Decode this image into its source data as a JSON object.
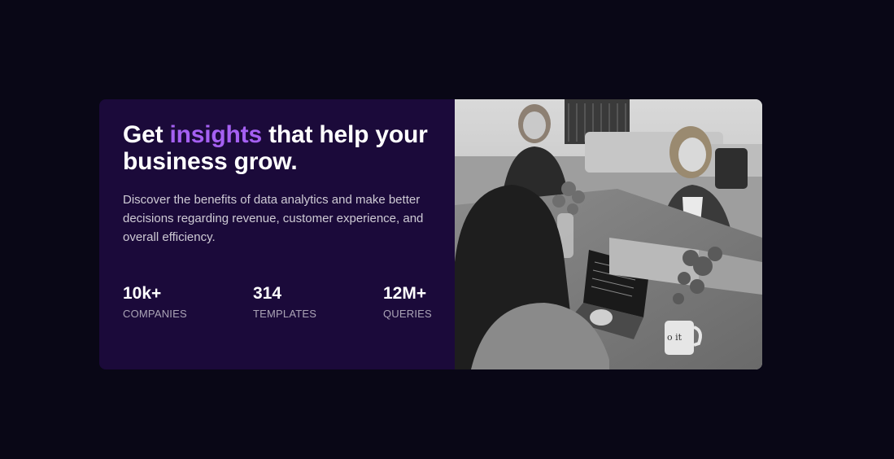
{
  "headline": {
    "prefix": "Get ",
    "accent": "insights",
    "suffix": " that help your business grow."
  },
  "description": "Discover the benefits of data analytics and make better decisions regarding revenue, customer experience, and overall efficiency.",
  "stats": [
    {
      "value": "10k+",
      "label": "COMPANIES"
    },
    {
      "value": "314",
      "label": "TEMPLATES"
    },
    {
      "value": "12M+",
      "label": "QUERIES"
    }
  ],
  "image": {
    "description_icon": "people-working-photo",
    "mug_text": "o it\nway"
  },
  "colors": {
    "page_bg": "#090716",
    "card_bg": "#1b0a3a",
    "accent": "#a560f2"
  }
}
